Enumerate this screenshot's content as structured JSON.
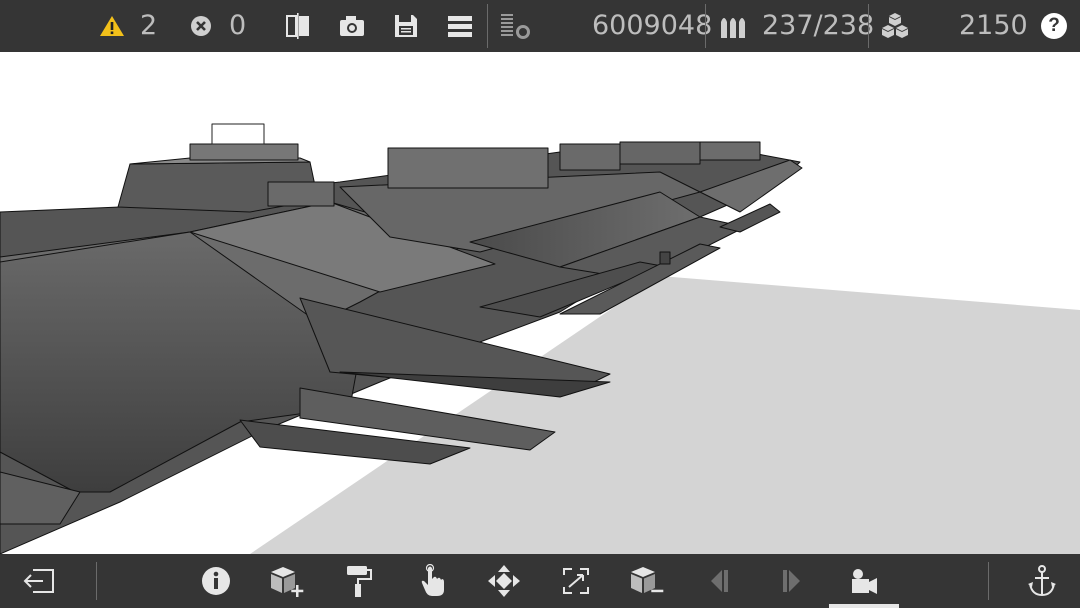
{
  "toolbar": {
    "warnings_count": "2",
    "errors_count": "0",
    "points": "6009048",
    "ammo": "237/238",
    "blocks": "2150",
    "help_label": "?"
  },
  "icons": {
    "warning": "warning-icon",
    "error": "error-icon",
    "mirror": "mirror-icon",
    "camera": "camera-icon",
    "save": "save-icon",
    "menu": "menu-icon",
    "stats": "stats-icon",
    "ammo": "ammo-icon",
    "blocks": "blocks-icon",
    "help": "help-icon"
  },
  "bottom_tools": [
    "exit",
    "info",
    "add-block",
    "paint",
    "interact",
    "move",
    "select",
    "remove-block",
    "previous",
    "next",
    "camera-mode",
    "anchor"
  ],
  "colors": {
    "bar_bg": "#353535",
    "icon": "#e6e6e6",
    "warning": "#f2c01a",
    "ship": "#5c5c5c",
    "floor": "#d4d4d4"
  }
}
